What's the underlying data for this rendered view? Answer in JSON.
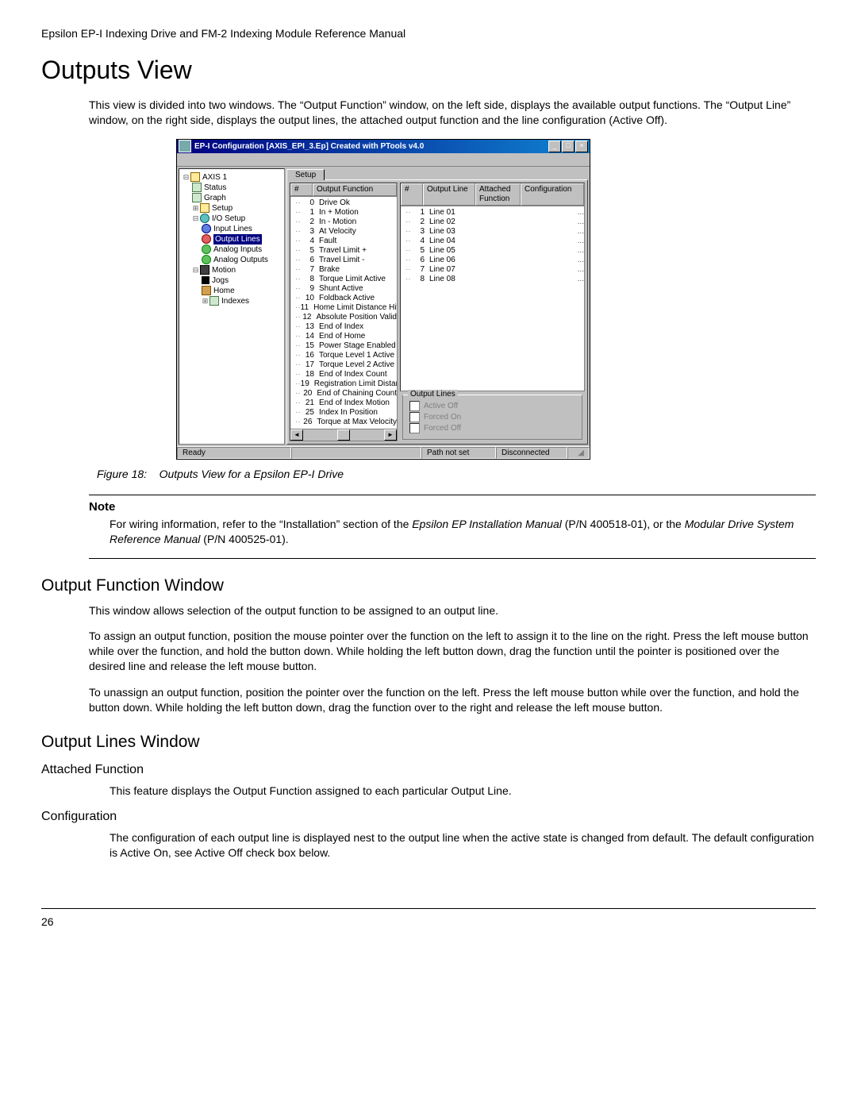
{
  "doc_header": "Epsilon EP-I Indexing Drive and FM-2 Indexing Module Reference Manual",
  "section_title": "Outputs View",
  "intro_text": "This view is divided into two windows. The “Output Function” window, on the left side, displays the available output functions. The “Output Line” window, on the right side, displays the output lines, the attached output function and the line configuration (Active Off).",
  "figure_caption_label": "Figure 18:",
  "figure_caption_text": "Outputs View for a Epsilon EP-I Drive",
  "note_label": "Note",
  "note_text_1": "For wiring information, refer to the “Installation” section of the ",
  "note_em_1": "Epsilon EP Installation Manual",
  "note_text_2": " (P/N 400518-01), or the ",
  "note_em_2": "Modular Drive System Reference Manual",
  "note_text_3": " (P/N 400525-01).",
  "ofw_title": "Output Function Window",
  "ofw_p1": "This window allows selection of the output function to be assigned to an output line.",
  "ofw_p2": "To assign an output function, position the mouse pointer over the function on the left to assign it to the line on the right. Press the left mouse button while over the function, and hold the button down. While holding the left button down, drag the function until the pointer is positioned over the desired line and release the left mouse button.",
  "ofw_p3": "To unassign an output function, position the pointer over the function on the left. Press the left mouse button while over the function, and hold the button down. While holding the left button down, drag the function over to the right and release the left mouse button.",
  "olw_title": "Output Lines Window",
  "attached_title": "Attached Function",
  "attached_p": "This feature displays the Output Function assigned to each particular Output Line.",
  "config_title": "Configuration",
  "config_p": "The configuration of each output line is displayed nest to the output line when the active state is changed from default. The default configuration is Active On, see Active Off check box below.",
  "page_number": "26",
  "win": {
    "title": "EP-I Configuration  [AXIS_EPI_3.Ep] Created with PTools v4.0",
    "tab_label": "Setup",
    "tree": {
      "root": "AXIS 1",
      "items": [
        "Status",
        "Graph",
        "Setup",
        "I/O Setup",
        "Input Lines",
        "Output Lines",
        "Analog Inputs",
        "Analog Outputs",
        "Motion",
        "Jogs",
        "Home",
        "Indexes"
      ]
    },
    "func_headers": {
      "num": "#",
      "fn": "Output Function"
    },
    "functions": [
      {
        "n": "0",
        "name": "Drive Ok"
      },
      {
        "n": "1",
        "name": "In + Motion"
      },
      {
        "n": "2",
        "name": "In - Motion"
      },
      {
        "n": "3",
        "name": "At Velocity"
      },
      {
        "n": "4",
        "name": "Fault"
      },
      {
        "n": "5",
        "name": "Travel Limit +"
      },
      {
        "n": "6",
        "name": "Travel Limit -"
      },
      {
        "n": "7",
        "name": "Brake"
      },
      {
        "n": "8",
        "name": "Torque Limit Active"
      },
      {
        "n": "9",
        "name": "Shunt Active"
      },
      {
        "n": "10",
        "name": "Foldback Active"
      },
      {
        "n": "11",
        "name": "Home Limit Distance Hit"
      },
      {
        "n": "12",
        "name": "Absolute Position Valid"
      },
      {
        "n": "13",
        "name": "End of Index"
      },
      {
        "n": "14",
        "name": "End of Home"
      },
      {
        "n": "15",
        "name": "Power Stage Enabled"
      },
      {
        "n": "16",
        "name": "Torque Level 1 Active"
      },
      {
        "n": "17",
        "name": "Torque Level 2 Active"
      },
      {
        "n": "18",
        "name": "End of Index Count"
      },
      {
        "n": "19",
        "name": "Registration Limit Distance H"
      },
      {
        "n": "20",
        "name": "End of Chaining Count"
      },
      {
        "n": "21",
        "name": "End of Index Motion"
      },
      {
        "n": "25",
        "name": "Index In Position"
      },
      {
        "n": "26",
        "name": "Torque at Max Velocity"
      }
    ],
    "line_headers": {
      "num": "#",
      "line": "Output Line",
      "attached": "Attached Function",
      "config": "Configuration"
    },
    "lines": [
      {
        "n": "1",
        "name": "Line 01",
        "conf": "..."
      },
      {
        "n": "2",
        "name": "Line 02",
        "conf": "..."
      },
      {
        "n": "3",
        "name": "Line 03",
        "conf": "..."
      },
      {
        "n": "4",
        "name": "Line 04",
        "conf": "..."
      },
      {
        "n": "5",
        "name": "Line 05",
        "conf": "..."
      },
      {
        "n": "6",
        "name": "Line 06",
        "conf": "..."
      },
      {
        "n": "7",
        "name": "Line 07",
        "conf": "..."
      },
      {
        "n": "8",
        "name": "Line 08",
        "conf": "..."
      }
    ],
    "group_title": "Output Lines",
    "chk_active_off": "Active Off",
    "chk_forced_on": "Forced On",
    "chk_forced_off": "Forced Off",
    "status": {
      "ready": "Ready",
      "path": "Path not set",
      "conn": "Disconnected"
    }
  }
}
